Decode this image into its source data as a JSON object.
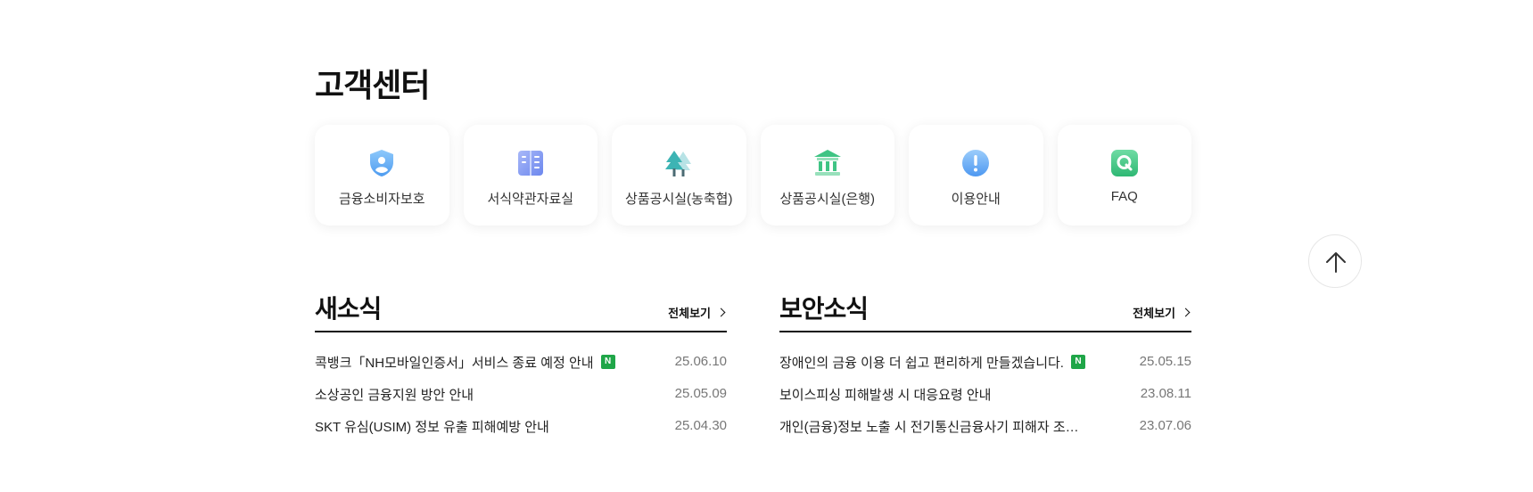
{
  "customer_center": {
    "title": "고객센터",
    "cards": [
      {
        "label": "금융소비자보호",
        "icon": "shield-user-icon"
      },
      {
        "label": "서식약관자료실",
        "icon": "document-binder-icon"
      },
      {
        "label": "상품공시실(농축협)",
        "icon": "tree-icon"
      },
      {
        "label": "상품공시실(은행)",
        "icon": "bank-building-icon"
      },
      {
        "label": "이용안내",
        "icon": "exclamation-icon"
      },
      {
        "label": "FAQ",
        "icon": "faq-q-icon"
      }
    ]
  },
  "news": {
    "title": "새소식",
    "more_label": "전체보기",
    "items": [
      {
        "title": "콕뱅크「NH모바일인증서」서비스 종료 예정 안내",
        "new": "N",
        "date": "25.06.10"
      },
      {
        "title": "소상공인 금융지원 방안 안내",
        "date": "25.05.09"
      },
      {
        "title": "SKT 유심(USIM) 정보 유출 피해예방 안내",
        "date": "25.04.30"
      }
    ]
  },
  "security": {
    "title": "보안소식",
    "more_label": "전체보기",
    "items": [
      {
        "title": "장애인의 금융 이용 더 쉽고 편리하게 만들겠습니다.",
        "new": "N",
        "date": "25.05.15"
      },
      {
        "title": "보이스피싱 피해발생 시 대응요령 안내",
        "date": "23.08.11"
      },
      {
        "title": "개인(금융)정보 노출 시 전기통신금융사기 피해자 조…",
        "date": "23.07.06"
      }
    ]
  },
  "scroll_top": {
    "icon": "arrow-up-icon"
  },
  "colors": {
    "new_badge": "#1fa648",
    "divider": "#111111",
    "date": "#777777"
  }
}
